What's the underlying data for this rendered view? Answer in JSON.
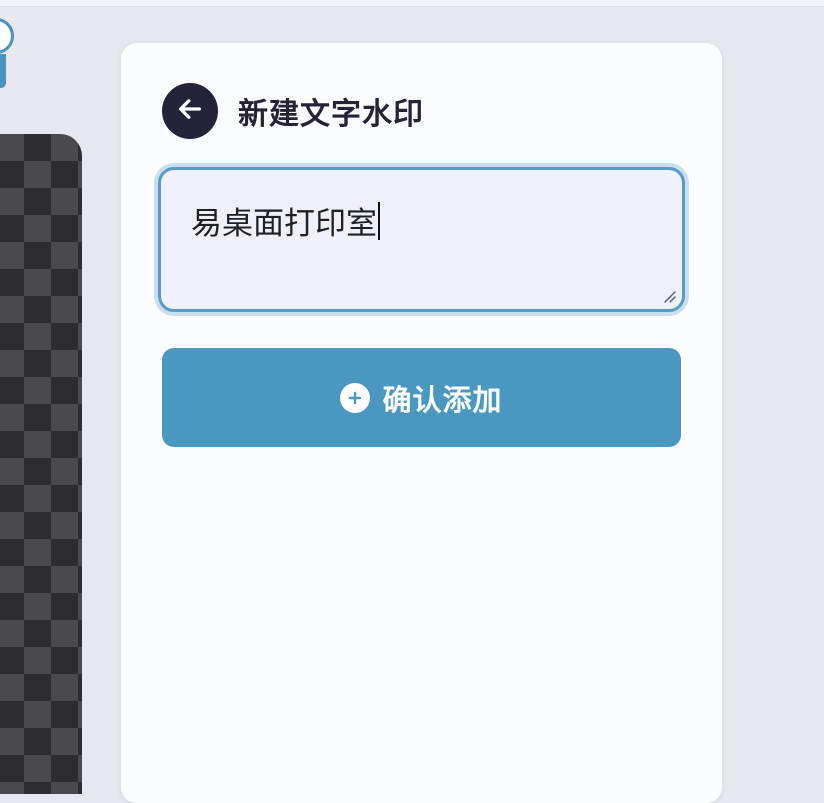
{
  "panel": {
    "title": "新建文字水印"
  },
  "watermark_input": {
    "value": "易桌面打印室"
  },
  "confirm_button": {
    "label": "确认添加"
  },
  "icons": {
    "back": "arrow-left-icon",
    "confirm": "plus-circle-icon",
    "resize": "resize-grip-icon"
  },
  "colors": {
    "accent": "#4a98c2",
    "back_button": "#232339",
    "input_border": "#5a9ac6",
    "input_bg": "#eef1fa",
    "panel_bg": "#fbfcfe",
    "page_bg": "#e6e8ee",
    "title_text": "#262338"
  }
}
